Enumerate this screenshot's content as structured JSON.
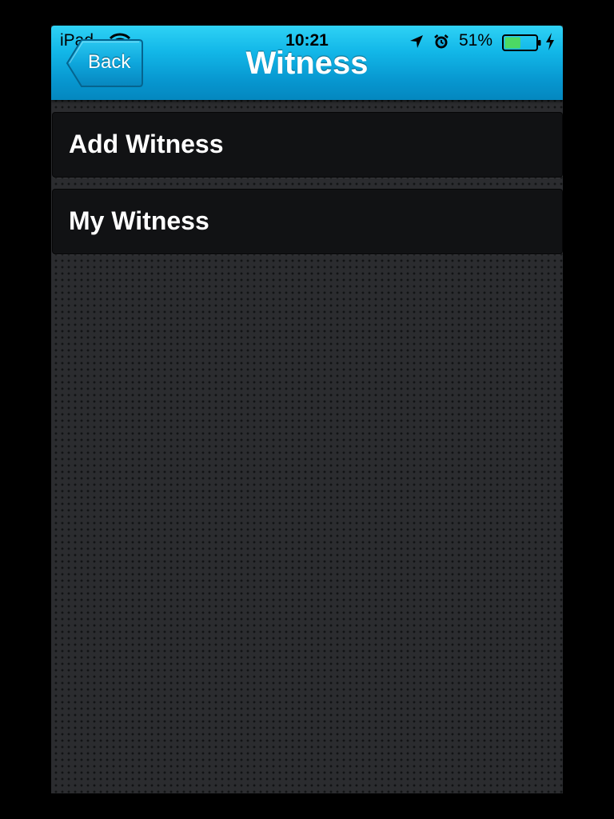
{
  "status_bar": {
    "carrier": "iPad",
    "time": "10:21",
    "battery_percent": "51%",
    "battery_level": 0.51,
    "icons": [
      "wifi-icon",
      "location-arrow-icon",
      "alarm-clock-icon",
      "battery-icon",
      "charging-bolt-icon"
    ]
  },
  "nav_bar": {
    "back_label": "Back",
    "title": "Witness"
  },
  "menu": {
    "items": [
      {
        "label": "Add Witness"
      },
      {
        "label": "My Witness"
      }
    ]
  },
  "colors": {
    "nav_bar_accent": "#0796cf",
    "background": "#2b2c2f",
    "row_background": "#111214",
    "battery_fill": "#4cd964"
  }
}
